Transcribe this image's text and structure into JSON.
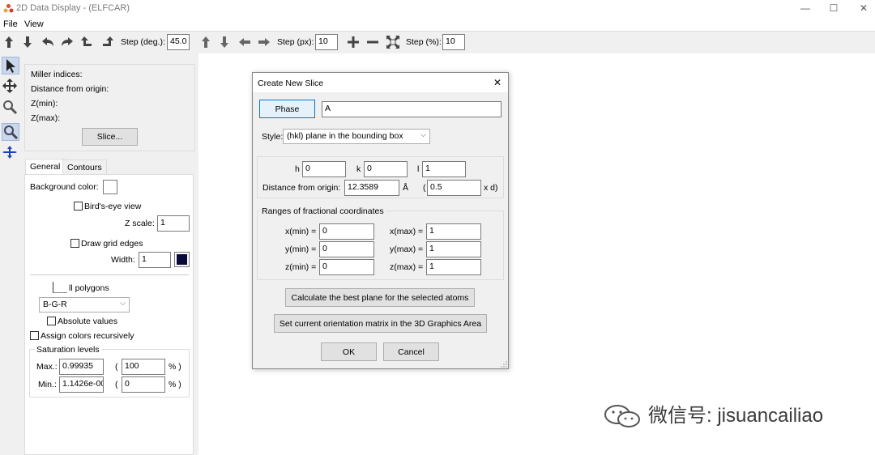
{
  "window": {
    "title": "2D Data Display - (ELFCAR)",
    "minimize": "—",
    "maximize": "☐",
    "close": "✕"
  },
  "menu": [
    "File",
    "View"
  ],
  "toolbar": {
    "step_deg_label": "Step (deg.):",
    "step_deg_value": "45.0",
    "step_px_label": "Step (px):",
    "step_px_value": "10",
    "step_pct_label": "Step (%):",
    "step_pct_value": "10"
  },
  "side": {
    "miller": "Miller indices:",
    "distance": "Distance from origin:",
    "zmin": "Z(min):",
    "zmax": "Z(max):",
    "slice_button": "Slice...",
    "tabs": [
      "General",
      "Contours"
    ],
    "bg_color": "Background color:",
    "birds_eye": "Bird's-eye view",
    "z_scale_label": "Z scale:",
    "z_scale_value": "1",
    "draw_grid": "Draw grid edges",
    "width_label": "Width:",
    "width_value": "1",
    "polygons": "ll polygons",
    "colormap": "B-G-R",
    "absolute": "Absolute values",
    "assign_recursive": "Assign colors recursively",
    "saturation": "Saturation levels",
    "max_label": "Max.:",
    "max_value": "0.99935",
    "max_pct": "100",
    "min_label": "Min.:",
    "min_value": "1.1426e-00",
    "min_pct": "0",
    "open_paren": "(",
    "pct_close": "% )"
  },
  "dialog": {
    "title": "Create New Slice",
    "close": "✕",
    "phase_button": "Phase",
    "phase_value": "A",
    "style_label": "Style:",
    "style_value": "(hkl) plane in the bounding box",
    "h_label": "h",
    "h_value": "0",
    "k_label": "k",
    "k_value": "0",
    "l_label": "l",
    "l_value": "1",
    "distance_label": "Distance from origin:",
    "distance_value": "12.3589",
    "angstrom": "Å",
    "open_paren": "(",
    "d_factor": "0.5",
    "xd": "x d)",
    "ranges_title": "Ranges of fractional coordinates",
    "xmin_label": "x(min) =",
    "xmin": "0",
    "ymin_label": "y(min) =",
    "ymin": "0",
    "zmin_label": "z(min) =",
    "zmin": "0",
    "xmax_label": "x(max) =",
    "xmax": "1",
    "ymax_label": "y(max) =",
    "ymax": "1",
    "zmax_label": "z(max) =",
    "zmax": "1",
    "calc_button": "Calculate the best plane for the selected atoms",
    "orient_button": "Set current orientation matrix in the 3D Graphics Area",
    "ok": "OK",
    "cancel": "Cancel"
  },
  "watermark": "微信号: jisuancailiao",
  "colors": {
    "accent": "#0078d7",
    "toolbar_bg": "#f0f0f0",
    "grid_edge_color": "#0a0a3a"
  }
}
